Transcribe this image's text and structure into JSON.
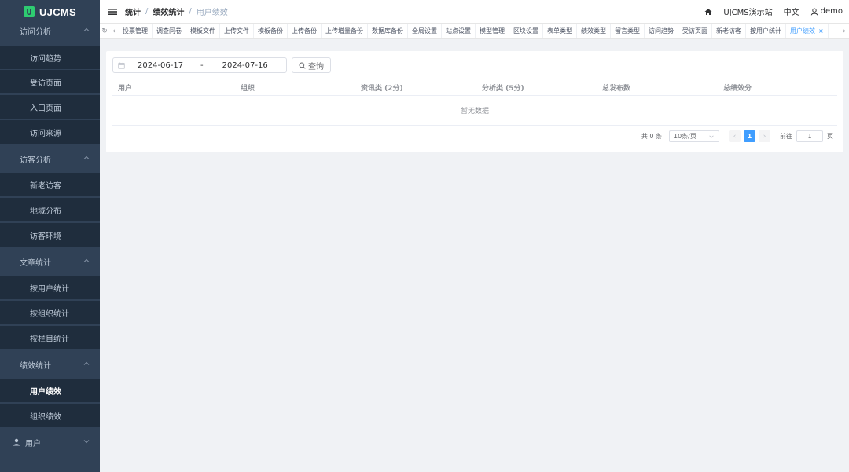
{
  "brand": {
    "logo_mark": "U",
    "name": "UJCMS"
  },
  "sidebar": {
    "groups": [
      {
        "label": "访问分析",
        "items": [
          "访问趋势",
          "受访页面",
          "入口页面",
          "访问来源"
        ]
      },
      {
        "label": "访客分析",
        "items": [
          "新老访客",
          "地域分布",
          "访客环境"
        ]
      },
      {
        "label": "文章统计",
        "items": [
          "按用户统计",
          "按组织统计",
          "按栏目统计"
        ]
      },
      {
        "label": "绩效统计",
        "items": [
          "用户绩效",
          "组织绩效"
        ]
      },
      {
        "label": "用户",
        "items": []
      }
    ],
    "active_item": "用户绩效"
  },
  "header": {
    "breadcrumb": [
      "统计",
      "绩效统计",
      "用户绩效"
    ],
    "site_name": "UJCMS演示站",
    "language": "中文",
    "username": "demo"
  },
  "tabs": [
    "投票管理",
    "调查问卷",
    "模板文件",
    "上传文件",
    "模板备份",
    "上传备份",
    "上传增量备份",
    "数据库备份",
    "全局设置",
    "站点设置",
    "模型管理",
    "区块设置",
    "表单类型",
    "绩效类型",
    "留言类型",
    "访问趋势",
    "受访页面",
    "新老访客",
    "按用户统计",
    "用户绩效"
  ],
  "active_tab": "用户绩效",
  "filter": {
    "start_date": "2024-06-17",
    "separator": "-",
    "end_date": "2024-07-16",
    "query_label": "查询"
  },
  "table": {
    "columns": [
      "用户",
      "组织",
      "资讯类 (2分)",
      "分析类 (5分)",
      "总发布数",
      "总绩效分"
    ],
    "empty_text": "暂无数据"
  },
  "pagination": {
    "total_text": "共 0 条",
    "page_size": "10条/页",
    "current_page": "1",
    "goto_label": "前往",
    "goto_value": "1",
    "page_unit": "页"
  },
  "colors": {
    "sidebar_bg": "#304156",
    "accent": "#409eff",
    "logo_green": "#2ecc71"
  }
}
